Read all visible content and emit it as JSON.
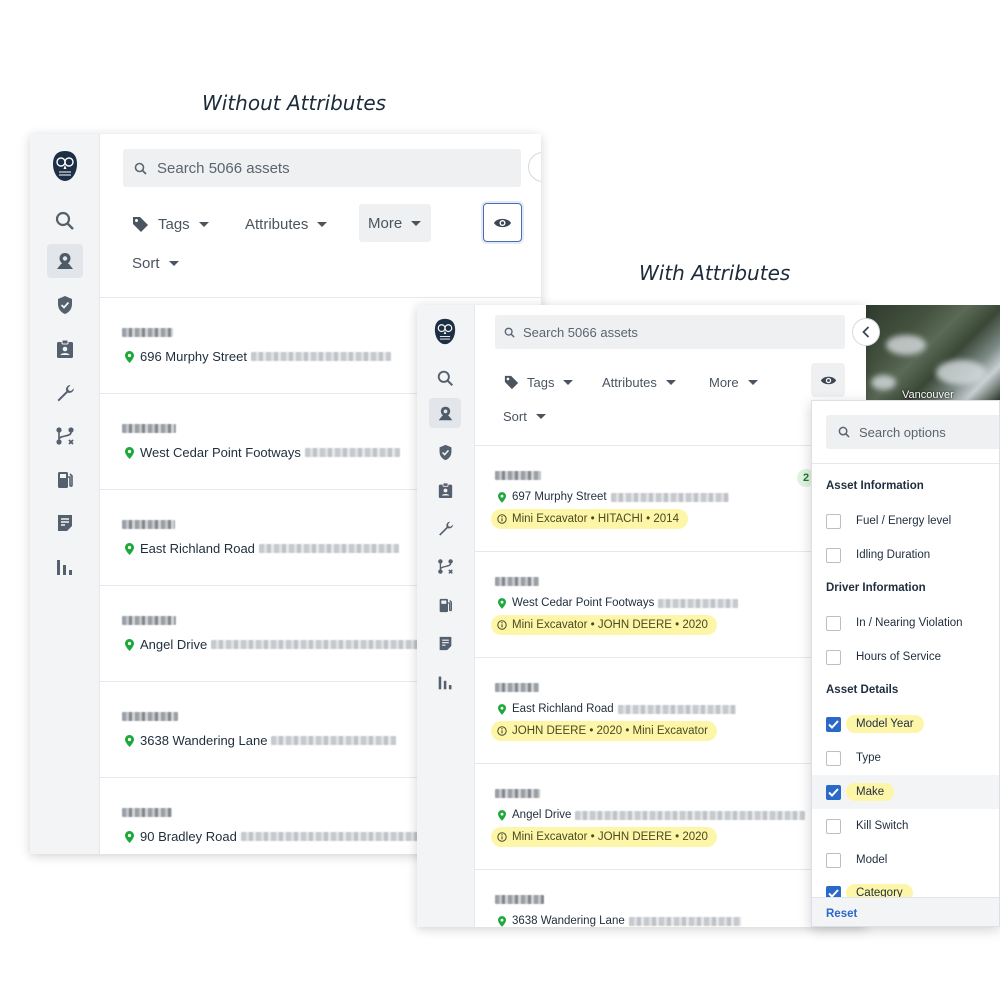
{
  "captions": {
    "left": "Without Attributes",
    "right": "With Attributes"
  },
  "left_panel": {
    "search_placeholder": "Search 5066 assets",
    "filters": {
      "tags": "Tags",
      "attributes": "Attributes",
      "more": "More",
      "sort": "Sort"
    },
    "assets": [
      {
        "address": "696 Murphy Street"
      },
      {
        "address": "West Cedar Point Footways"
      },
      {
        "address": "East Richland Road"
      },
      {
        "address": "Angel Drive"
      },
      {
        "address": "3638 Wandering Lane"
      },
      {
        "address": "90 Bradley Road"
      }
    ]
  },
  "right_panel": {
    "search_placeholder": "Search 5066 assets",
    "filters": {
      "tags": "Tags",
      "attributes": "Attributes",
      "more": "More",
      "sort": "Sort"
    },
    "first_badge": "2",
    "assets": [
      {
        "address": "697 Murphy Street",
        "attributes": "Mini Excavator • HITACHI • 2014"
      },
      {
        "address": "West Cedar Point Footways",
        "attributes": "Mini Excavator • JOHN DEERE • 2020"
      },
      {
        "address": "East Richland Road",
        "attributes": "JOHN DEERE • 2020 • Mini Excavator"
      },
      {
        "address": "Angel Drive",
        "attributes": "Mini Excavator • JOHN DEERE • 2020"
      },
      {
        "address": "3638 Wandering Lane",
        "attributes": ""
      }
    ],
    "map_label": "Vancouver"
  },
  "options_dropdown": {
    "search_placeholder": "Search options",
    "sections": [
      {
        "title": "Asset Information",
        "options": [
          {
            "label": "Fuel / Energy level",
            "checked": false
          },
          {
            "label": "Idling Duration",
            "checked": false
          }
        ]
      },
      {
        "title": "Driver Information",
        "options": [
          {
            "label": "In / Nearing Violation",
            "checked": false
          },
          {
            "label": "Hours of Service",
            "checked": false
          }
        ]
      },
      {
        "title": "Asset Details",
        "options": [
          {
            "label": "Model Year",
            "checked": true
          },
          {
            "label": "Type",
            "checked": false
          },
          {
            "label": "Make",
            "checked": true
          },
          {
            "label": "Kill Switch",
            "checked": false
          },
          {
            "label": "Model",
            "checked": false
          },
          {
            "label": "Category",
            "checked": true
          }
        ]
      }
    ],
    "reset_label": "Reset"
  },
  "colors": {
    "accent": "#2a68c9",
    "attribute_highlight": "#fdf6a8",
    "pin": "#1fa83c",
    "logo": "#1d2f45"
  }
}
